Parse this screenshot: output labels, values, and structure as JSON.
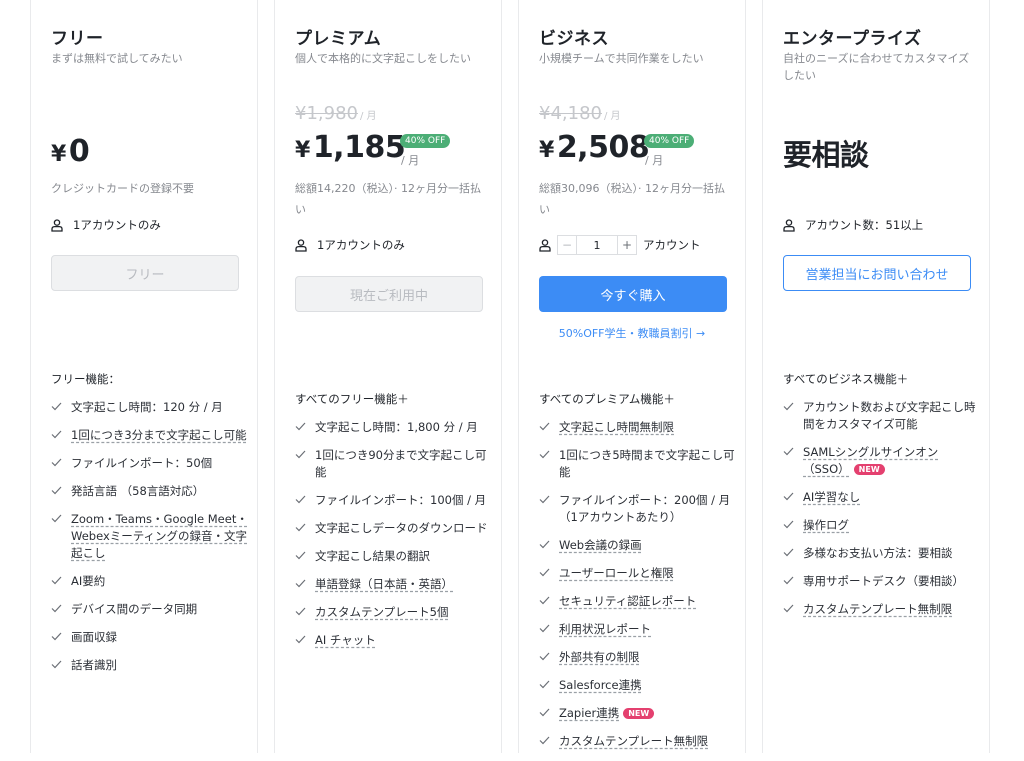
{
  "plans": [
    {
      "name": "フリー",
      "tagline": "まずは無料で試してみたい",
      "currency": "¥",
      "price": "0",
      "note": "クレジットカードの登録不要",
      "account_text": "1アカウントのみ",
      "button": "フリー",
      "features_heading": "フリー機能：",
      "features": [
        {
          "text": "文字起こし時間：120 分 / 月"
        },
        {
          "text": "1回につき3分まで文字起こし可能"
        },
        {
          "text": "ファイルインポート：50個"
        },
        {
          "text": "発話言語 （58言語対応）"
        },
        {
          "text": "Zoom・Teams・Google Meet・Webexミーティングの録音・文字起こし"
        },
        {
          "text": "AI要約"
        },
        {
          "text": "デバイス間のデータ同期"
        },
        {
          "text": "画面収録"
        },
        {
          "text": "話者識別"
        }
      ]
    },
    {
      "name": "プレミアム",
      "tagline": "個人で本格的に文字起こしをしたい",
      "old_price": "¥1,980",
      "per_month": "/ 月",
      "currency": "¥",
      "price": "1,185",
      "discount": "40% OFF",
      "note": "総額14,220（税込）· 12ヶ月分一括払い",
      "account_text": "1アカウントのみ",
      "button": "現在ご利用中",
      "features_heading": "すべてのフリー機能＋",
      "features": [
        {
          "text": "文字起こし時間：1,800 分 / 月"
        },
        {
          "text": "1回につき90分まで文字起こし可能"
        },
        {
          "text": "ファイルインポート：100個 / 月"
        },
        {
          "text": "文字起こしデータのダウンロード"
        },
        {
          "text": "文字起こし結果の翻訳"
        },
        {
          "text": "単語登録（日本語・英語）"
        },
        {
          "text": "カスタムテンプレート5個"
        },
        {
          "text": "AI チャット"
        }
      ]
    },
    {
      "name": "ビジネス",
      "tagline": "小規模チームで共同作業をしたい",
      "old_price": "¥4,180",
      "per_month": "/ 月",
      "currency": "¥",
      "price": "2,508",
      "discount": "40% OFF",
      "note": "総額30,096（税込）· 12ヶ月分一括払い",
      "stepper_minus": "−",
      "stepper_value": "1",
      "stepper_plus": "+",
      "account_text": "アカウント",
      "button": "今すぐ購入",
      "link": "50%OFF学生・教職員割引 →",
      "features_heading": "すべてのプレミアム機能＋",
      "features": [
        {
          "text": "文字起こし時間無制限"
        },
        {
          "text": "1回につき5時間まで文字起こし可能"
        },
        {
          "text": "ファイルインポート：200個 / 月（1アカウントあたり）"
        },
        {
          "text": "Web会議の録画"
        },
        {
          "text": "ユーザーロールと権限"
        },
        {
          "text": "セキュリティ認証レポート"
        },
        {
          "text": "利用状況レポート"
        },
        {
          "text": "外部共有の制限"
        },
        {
          "text": "Salesforce連携"
        },
        {
          "text": "Zapier連携",
          "badge": "NEW"
        },
        {
          "text": "カスタムテンプレート無制限"
        }
      ]
    },
    {
      "name": "エンタープライズ",
      "tagline": "自社のニーズに合わせてカスタマイズしたい",
      "price_text": "要相談",
      "account_text": "アカウント数：51以上",
      "button": "営業担当にお問い合わせ",
      "features_heading": "すべてのビジネス機能＋",
      "features": [
        {
          "text": "アカウント数および文字起こし時間をカスタマイズ可能"
        },
        {
          "text": "SAMLシングルサインオン（SSO）",
          "badge": "NEW"
        },
        {
          "text": "AI学習なし"
        },
        {
          "text": "操作ログ"
        },
        {
          "text": "多様なお支払い方法：要相談"
        },
        {
          "text": "専用サポートデスク（要相談）"
        },
        {
          "text": "カスタムテンプレート無制限"
        }
      ]
    }
  ],
  "colors": {
    "accent": "#3c8cf5",
    "discount_badge": "#4cae76",
    "new_badge": "#e4406f",
    "muted_text": "#86898f"
  }
}
